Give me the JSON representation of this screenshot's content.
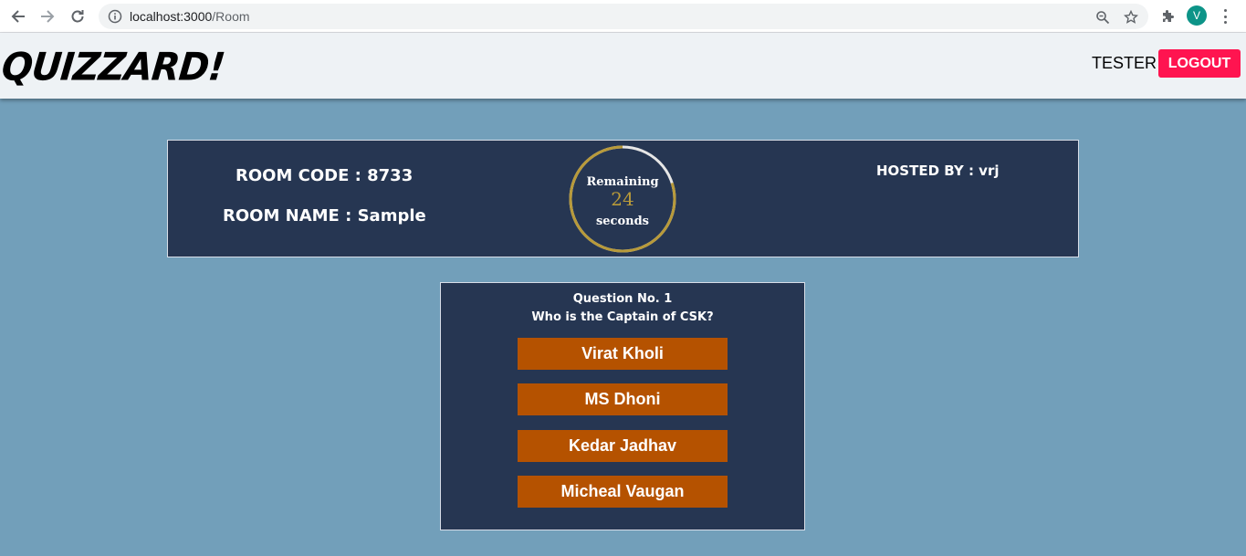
{
  "browser": {
    "url_host": "localhost:3000",
    "url_path": "/Room",
    "profile_initial": "V",
    "icons": [
      "back-arrow-icon",
      "forward-arrow-icon",
      "reload-icon",
      "info-icon",
      "zoom-icon",
      "star-icon",
      "puzzle-icon",
      "kebab-menu-icon"
    ]
  },
  "header": {
    "logo_text": "QUIZZARD!",
    "user_name": "TESTER",
    "logout_label": "LOGOUT"
  },
  "room": {
    "code_text": "ROOM CODE : 8733",
    "name_text": "ROOM NAME : Sample",
    "hosted_by_text": "HOSTED BY : vrj"
  },
  "timer": {
    "top_label": "Remaining",
    "seconds_left": "24",
    "bottom_label": "seconds",
    "elapsed_fraction": 0.2
  },
  "question": {
    "number_text": "Question No. 1",
    "text": "Who is the Captain of CSK?",
    "options": [
      "Virat Kholi",
      "MS Dhoni",
      "Kedar Jadhav",
      "Micheal Vaugan"
    ]
  },
  "colors": {
    "page_bg": "#729fba",
    "panel_bg": "#263652",
    "option_bg": "#b55200",
    "logout_bg": "#ff1450",
    "timer_ring": "#b89a3a",
    "timer_track": "#e6e6e6"
  }
}
